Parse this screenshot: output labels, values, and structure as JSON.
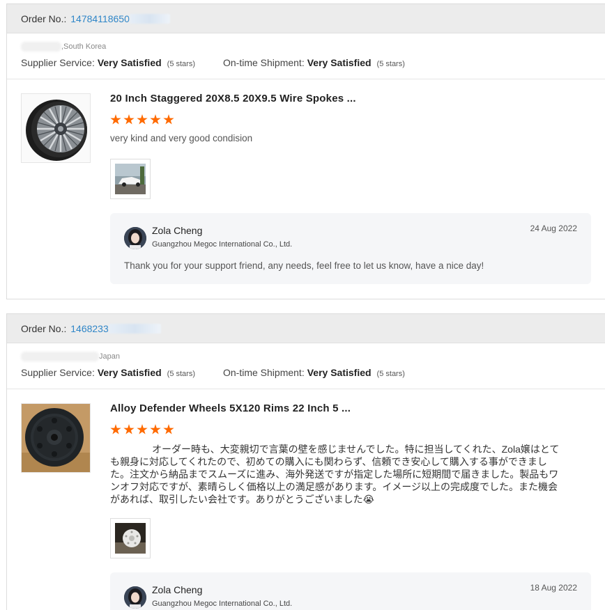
{
  "reviews": [
    {
      "order_label": "Order No.:",
      "order_number": "14784118650",
      "country": ",South Korea",
      "supplier_label": "Supplier Service:",
      "supplier_value": "Very Satisfied",
      "supplier_stars": "(5 stars)",
      "shipment_label": "On-time Shipment:",
      "shipment_value": "Very Satisfied",
      "shipment_stars": "(5 stars)",
      "product_title": "20 Inch Staggered 20X8.5 20X9.5 Wire Spokes ...",
      "rating": 5,
      "comment": "very kind and very good condision",
      "reply": {
        "name": "Zola Cheng",
        "company": "Guangzhou Megoc International Co., Ltd.",
        "date": "24 Aug 2022",
        "text": "Thank you for your support friend, any needs, feel free to let us know, have a nice day!"
      }
    },
    {
      "order_label": "Order No.:",
      "order_number": "1468233",
      "country": "Japan",
      "supplier_label": "Supplier Service:",
      "supplier_value": "Very Satisfied",
      "supplier_stars": "(5 stars)",
      "shipment_label": "On-time Shipment:",
      "shipment_value": "Very Satisfied",
      "shipment_stars": "(5 stars)",
      "product_title": "Alloy Defender Wheels 5X120 Rims 22 Inch 5 ...",
      "rating": 5,
      "comment": "オーダー時も、大変親切で言葉の壁を感じませんでした。特に担当してくれた、Zola嬢はとても親身に対応してくれたので、初めての購入にも関わらず、信頼でき安心して購入する事ができました。注文から納品までスムーズに進み、海外発送ですが指定した場所に短期間で届きました。製品もワンオフ対応ですが、素晴らしく価格以上の満足感があります。イメージ以上の完成度でした。また機会があれば、取引したい会社です。ありがとうございました😭",
      "reply": {
        "name": "Zola Cheng",
        "company": "Guangzhou Megoc International Co., Ltd.",
        "date": "18 Aug 2022"
      }
    }
  ],
  "colors": {
    "accent_link": "#2f86c8",
    "star": "#ff6a00",
    "header_bg": "#ececec",
    "reply_bg": "#f5f6f8"
  }
}
